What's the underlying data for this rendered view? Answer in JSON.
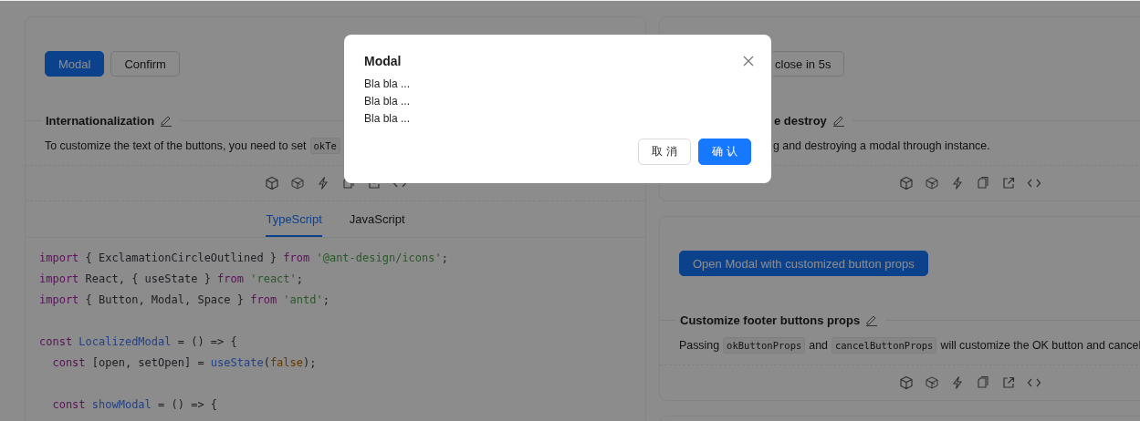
{
  "left_card": {
    "buttons": [
      {
        "label": "Modal",
        "kind": "primary"
      },
      {
        "label": "Confirm",
        "kind": "default"
      }
    ],
    "title": "Internationalization",
    "description": [
      {
        "kind": "text",
        "text": "To customize the text of the buttons, you need to set"
      },
      {
        "kind": "code",
        "text": "okTe"
      }
    ],
    "code_tabs": [
      {
        "label": "TypeScript",
        "selected": true
      },
      {
        "label": "JavaScript",
        "selected": false
      }
    ],
    "code_lines": [
      {
        "kind": "code",
        "indented": false,
        "tokens": [
          {
            "kind": "keyword",
            "text": "import"
          },
          {
            "kind": "plain",
            "text": " { ExclamationCircleOutlined } "
          },
          {
            "kind": "keyword",
            "text": "from"
          },
          {
            "kind": "string",
            "text": " '@ant-design/icons'"
          },
          {
            "kind": "plain",
            "text": ";"
          }
        ]
      },
      {
        "kind": "code",
        "indented": false,
        "tokens": [
          {
            "kind": "keyword",
            "text": "import"
          },
          {
            "kind": "plain",
            "text": " React, { useState } "
          },
          {
            "kind": "keyword",
            "text": "from"
          },
          {
            "kind": "string",
            "text": " 'react'"
          },
          {
            "kind": "plain",
            "text": ";"
          }
        ]
      },
      {
        "kind": "code",
        "indented": false,
        "tokens": [
          {
            "kind": "keyword",
            "text": "import"
          },
          {
            "kind": "plain",
            "text": " { Button, Modal, Space } "
          },
          {
            "kind": "keyword",
            "text": "from"
          },
          {
            "kind": "string",
            "text": " 'antd'"
          },
          {
            "kind": "plain",
            "text": ";"
          }
        ]
      },
      {
        "kind": "blank"
      },
      {
        "kind": "code",
        "indented": false,
        "tokens": [
          {
            "kind": "keyword",
            "text": "const"
          },
          {
            "kind": "name",
            "text": " LocalizedModal"
          },
          {
            "kind": "plain",
            "text": " = () => {"
          }
        ]
      },
      {
        "kind": "code",
        "indented": true,
        "tokens": [
          {
            "kind": "keyword",
            "text": "const"
          },
          {
            "kind": "plain",
            "text": " [open, setOpen] = "
          },
          {
            "kind": "name",
            "text": "useState"
          },
          {
            "kind": "plain",
            "text": "("
          },
          {
            "kind": "literal",
            "text": "false"
          },
          {
            "kind": "plain",
            "text": ");"
          }
        ]
      },
      {
        "kind": "blank"
      },
      {
        "kind": "code",
        "indented": true,
        "tokens": [
          {
            "kind": "keyword",
            "text": "const"
          },
          {
            "kind": "name",
            "text": " showModal"
          },
          {
            "kind": "plain",
            "text": " = () => {"
          }
        ]
      }
    ]
  },
  "right_cards": [
    {
      "buttons": [
        {
          "label": "close in 5s",
          "kind": "cut"
        }
      ],
      "title": "e destroy",
      "description": [
        {
          "kind": "text",
          "text": "g and destroying a modal through instance."
        }
      ]
    },
    {
      "buttons": [
        {
          "label": "Open Modal with customized button props",
          "kind": "primary"
        }
      ],
      "title": "Customize footer buttons props",
      "description": [
        {
          "kind": "text",
          "text": "Passing"
        },
        {
          "kind": "code",
          "text": "okButtonProps"
        },
        {
          "kind": "text",
          "text": "and"
        },
        {
          "kind": "code",
          "text": "cancelButtonProps"
        },
        {
          "kind": "text",
          "text": "will customize the OK button and cancel"
        }
      ]
    }
  ],
  "modal": {
    "title": "Modal",
    "body": [
      "Bla bla ...",
      "Bla bla ...",
      "Bla bla ..."
    ],
    "buttons": [
      {
        "label": "取 消",
        "kind": "default"
      },
      {
        "label": "确 认",
        "kind": "primary"
      }
    ]
  }
}
